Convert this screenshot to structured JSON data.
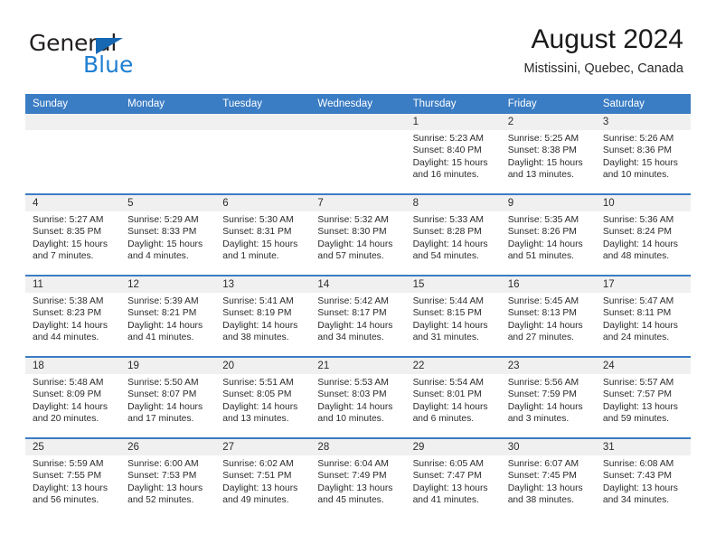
{
  "brand": {
    "name_dark": "General",
    "name_blue": "Blue",
    "accent_blue": "#1f7fd1",
    "triangle_blue": "#1668b3"
  },
  "header": {
    "title": "August 2024",
    "subtitle": "Mistissini, Quebec, Canada"
  },
  "calendar": {
    "header_bg": "#3b7dc4",
    "row_shade": "#f0f0f0",
    "weekdays": [
      "Sunday",
      "Monday",
      "Tuesday",
      "Wednesday",
      "Thursday",
      "Friday",
      "Saturday"
    ],
    "weeks": [
      [
        {
          "day": "",
          "lines": []
        },
        {
          "day": "",
          "lines": []
        },
        {
          "day": "",
          "lines": []
        },
        {
          "day": "",
          "lines": []
        },
        {
          "day": "1",
          "lines": [
            "Sunrise: 5:23 AM",
            "Sunset: 8:40 PM",
            "Daylight: 15 hours",
            "and 16 minutes."
          ]
        },
        {
          "day": "2",
          "lines": [
            "Sunrise: 5:25 AM",
            "Sunset: 8:38 PM",
            "Daylight: 15 hours",
            "and 13 minutes."
          ]
        },
        {
          "day": "3",
          "lines": [
            "Sunrise: 5:26 AM",
            "Sunset: 8:36 PM",
            "Daylight: 15 hours",
            "and 10 minutes."
          ]
        }
      ],
      [
        {
          "day": "4",
          "lines": [
            "Sunrise: 5:27 AM",
            "Sunset: 8:35 PM",
            "Daylight: 15 hours",
            "and 7 minutes."
          ]
        },
        {
          "day": "5",
          "lines": [
            "Sunrise: 5:29 AM",
            "Sunset: 8:33 PM",
            "Daylight: 15 hours",
            "and 4 minutes."
          ]
        },
        {
          "day": "6",
          "lines": [
            "Sunrise: 5:30 AM",
            "Sunset: 8:31 PM",
            "Daylight: 15 hours",
            "and 1 minute."
          ]
        },
        {
          "day": "7",
          "lines": [
            "Sunrise: 5:32 AM",
            "Sunset: 8:30 PM",
            "Daylight: 14 hours",
            "and 57 minutes."
          ]
        },
        {
          "day": "8",
          "lines": [
            "Sunrise: 5:33 AM",
            "Sunset: 8:28 PM",
            "Daylight: 14 hours",
            "and 54 minutes."
          ]
        },
        {
          "day": "9",
          "lines": [
            "Sunrise: 5:35 AM",
            "Sunset: 8:26 PM",
            "Daylight: 14 hours",
            "and 51 minutes."
          ]
        },
        {
          "day": "10",
          "lines": [
            "Sunrise: 5:36 AM",
            "Sunset: 8:24 PM",
            "Daylight: 14 hours",
            "and 48 minutes."
          ]
        }
      ],
      [
        {
          "day": "11",
          "lines": [
            "Sunrise: 5:38 AM",
            "Sunset: 8:23 PM",
            "Daylight: 14 hours",
            "and 44 minutes."
          ]
        },
        {
          "day": "12",
          "lines": [
            "Sunrise: 5:39 AM",
            "Sunset: 8:21 PM",
            "Daylight: 14 hours",
            "and 41 minutes."
          ]
        },
        {
          "day": "13",
          "lines": [
            "Sunrise: 5:41 AM",
            "Sunset: 8:19 PM",
            "Daylight: 14 hours",
            "and 38 minutes."
          ]
        },
        {
          "day": "14",
          "lines": [
            "Sunrise: 5:42 AM",
            "Sunset: 8:17 PM",
            "Daylight: 14 hours",
            "and 34 minutes."
          ]
        },
        {
          "day": "15",
          "lines": [
            "Sunrise: 5:44 AM",
            "Sunset: 8:15 PM",
            "Daylight: 14 hours",
            "and 31 minutes."
          ]
        },
        {
          "day": "16",
          "lines": [
            "Sunrise: 5:45 AM",
            "Sunset: 8:13 PM",
            "Daylight: 14 hours",
            "and 27 minutes."
          ]
        },
        {
          "day": "17",
          "lines": [
            "Sunrise: 5:47 AM",
            "Sunset: 8:11 PM",
            "Daylight: 14 hours",
            "and 24 minutes."
          ]
        }
      ],
      [
        {
          "day": "18",
          "lines": [
            "Sunrise: 5:48 AM",
            "Sunset: 8:09 PM",
            "Daylight: 14 hours",
            "and 20 minutes."
          ]
        },
        {
          "day": "19",
          "lines": [
            "Sunrise: 5:50 AM",
            "Sunset: 8:07 PM",
            "Daylight: 14 hours",
            "and 17 minutes."
          ]
        },
        {
          "day": "20",
          "lines": [
            "Sunrise: 5:51 AM",
            "Sunset: 8:05 PM",
            "Daylight: 14 hours",
            "and 13 minutes."
          ]
        },
        {
          "day": "21",
          "lines": [
            "Sunrise: 5:53 AM",
            "Sunset: 8:03 PM",
            "Daylight: 14 hours",
            "and 10 minutes."
          ]
        },
        {
          "day": "22",
          "lines": [
            "Sunrise: 5:54 AM",
            "Sunset: 8:01 PM",
            "Daylight: 14 hours",
            "and 6 minutes."
          ]
        },
        {
          "day": "23",
          "lines": [
            "Sunrise: 5:56 AM",
            "Sunset: 7:59 PM",
            "Daylight: 14 hours",
            "and 3 minutes."
          ]
        },
        {
          "day": "24",
          "lines": [
            "Sunrise: 5:57 AM",
            "Sunset: 7:57 PM",
            "Daylight: 13 hours",
            "and 59 minutes."
          ]
        }
      ],
      [
        {
          "day": "25",
          "lines": [
            "Sunrise: 5:59 AM",
            "Sunset: 7:55 PM",
            "Daylight: 13 hours",
            "and 56 minutes."
          ]
        },
        {
          "day": "26",
          "lines": [
            "Sunrise: 6:00 AM",
            "Sunset: 7:53 PM",
            "Daylight: 13 hours",
            "and 52 minutes."
          ]
        },
        {
          "day": "27",
          "lines": [
            "Sunrise: 6:02 AM",
            "Sunset: 7:51 PM",
            "Daylight: 13 hours",
            "and 49 minutes."
          ]
        },
        {
          "day": "28",
          "lines": [
            "Sunrise: 6:04 AM",
            "Sunset: 7:49 PM",
            "Daylight: 13 hours",
            "and 45 minutes."
          ]
        },
        {
          "day": "29",
          "lines": [
            "Sunrise: 6:05 AM",
            "Sunset: 7:47 PM",
            "Daylight: 13 hours",
            "and 41 minutes."
          ]
        },
        {
          "day": "30",
          "lines": [
            "Sunrise: 6:07 AM",
            "Sunset: 7:45 PM",
            "Daylight: 13 hours",
            "and 38 minutes."
          ]
        },
        {
          "day": "31",
          "lines": [
            "Sunrise: 6:08 AM",
            "Sunset: 7:43 PM",
            "Daylight: 13 hours",
            "and 34 minutes."
          ]
        }
      ]
    ]
  }
}
